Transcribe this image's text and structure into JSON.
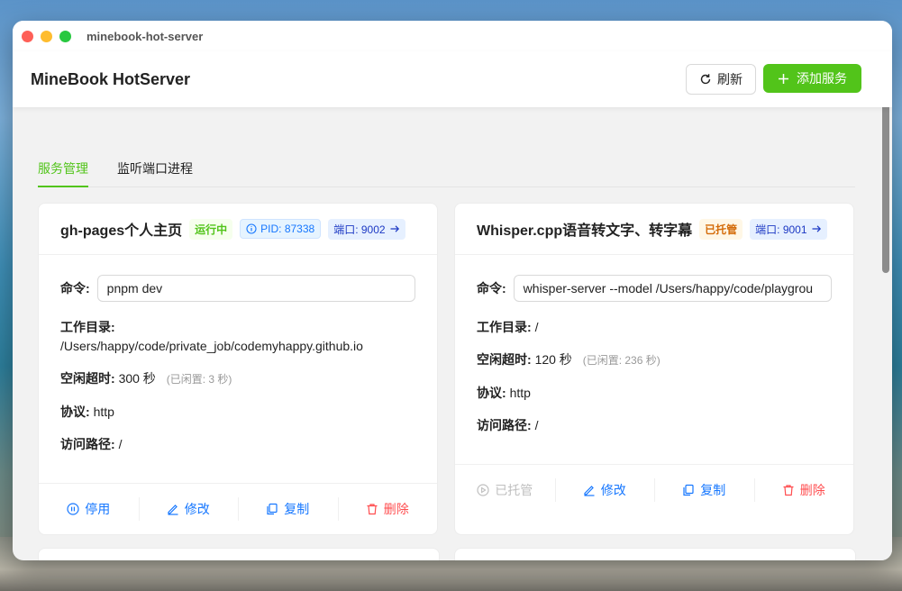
{
  "window": {
    "title": "minebook-hot-server"
  },
  "header": {
    "app_title": "MineBook HotServer",
    "refresh_label": "刷新",
    "add_label": "添加服务"
  },
  "tabs": [
    {
      "label": "服务管理",
      "active": true
    },
    {
      "label": "监听端口进程",
      "active": false
    }
  ],
  "cards": [
    {
      "name": "gh-pages个人主页",
      "status": "运行中",
      "pid": "PID: 87338",
      "port": "端口: 9002",
      "command_label": "命令:",
      "command": "pnpm dev",
      "workdir_label": "工作目录:",
      "workdir": "/Users/happy/code/private_job/codemyhappy.github.io",
      "timeout_label": "空闲超时:",
      "timeout": "300 秒",
      "idle": "(已闲置: 3 秒)",
      "protocol_label": "协议:",
      "protocol": "http",
      "path_label": "访问路径:",
      "path": "/",
      "actions": {
        "toggle": "停用",
        "edit": "修改",
        "copy": "复制",
        "delete": "删除"
      }
    },
    {
      "name": "Whisper.cpp语音转文字、转字幕",
      "status": "已托管",
      "port": "端口: 9001",
      "command_label": "命令:",
      "command": "whisper-server --model /Users/happy/code/playgrou",
      "workdir_label": "工作目录:",
      "workdir": "/",
      "timeout_label": "空闲超时:",
      "timeout": "120 秒",
      "idle": "(已闲置: 236 秒)",
      "protocol_label": "协议:",
      "protocol": "http",
      "path_label": "访问路径:",
      "path": "/",
      "actions": {
        "toggle": "已托管",
        "edit": "修改",
        "copy": "复制",
        "delete": "删除"
      }
    }
  ],
  "colors": {
    "accent": "#52c41a",
    "link": "#1677ff",
    "danger": "#ff4d4f",
    "hosted": "#d46b08"
  },
  "icons": [
    "refresh-icon",
    "plus-icon",
    "info-icon",
    "arrow-right-icon",
    "pause-circle-icon",
    "play-circle-icon",
    "edit-icon",
    "copy-icon",
    "trash-icon"
  ]
}
